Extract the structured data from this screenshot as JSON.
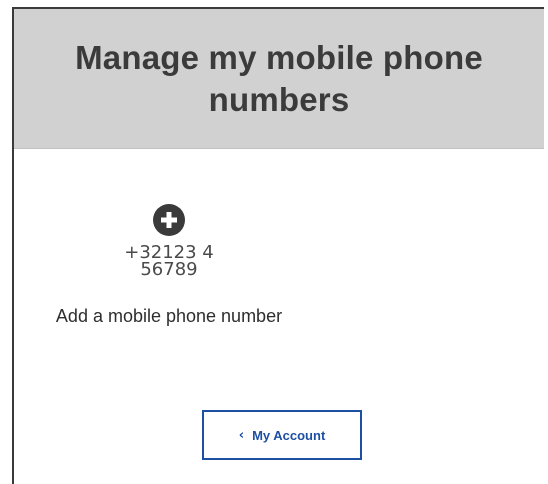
{
  "header": {
    "title": "Manage my mobile phone numbers"
  },
  "add_phone": {
    "icon": "plus-circle-icon",
    "example_number": "+32123 456789",
    "label": "Add a mobile phone number"
  },
  "account_button": {
    "icon": "chevron-left-icon",
    "label": "My Account"
  },
  "colors": {
    "header_background": "#d1d1d1",
    "title_text": "#3b3b3b",
    "accent_blue": "#1d4fa3",
    "icon_dark": "#3a3a3a"
  }
}
